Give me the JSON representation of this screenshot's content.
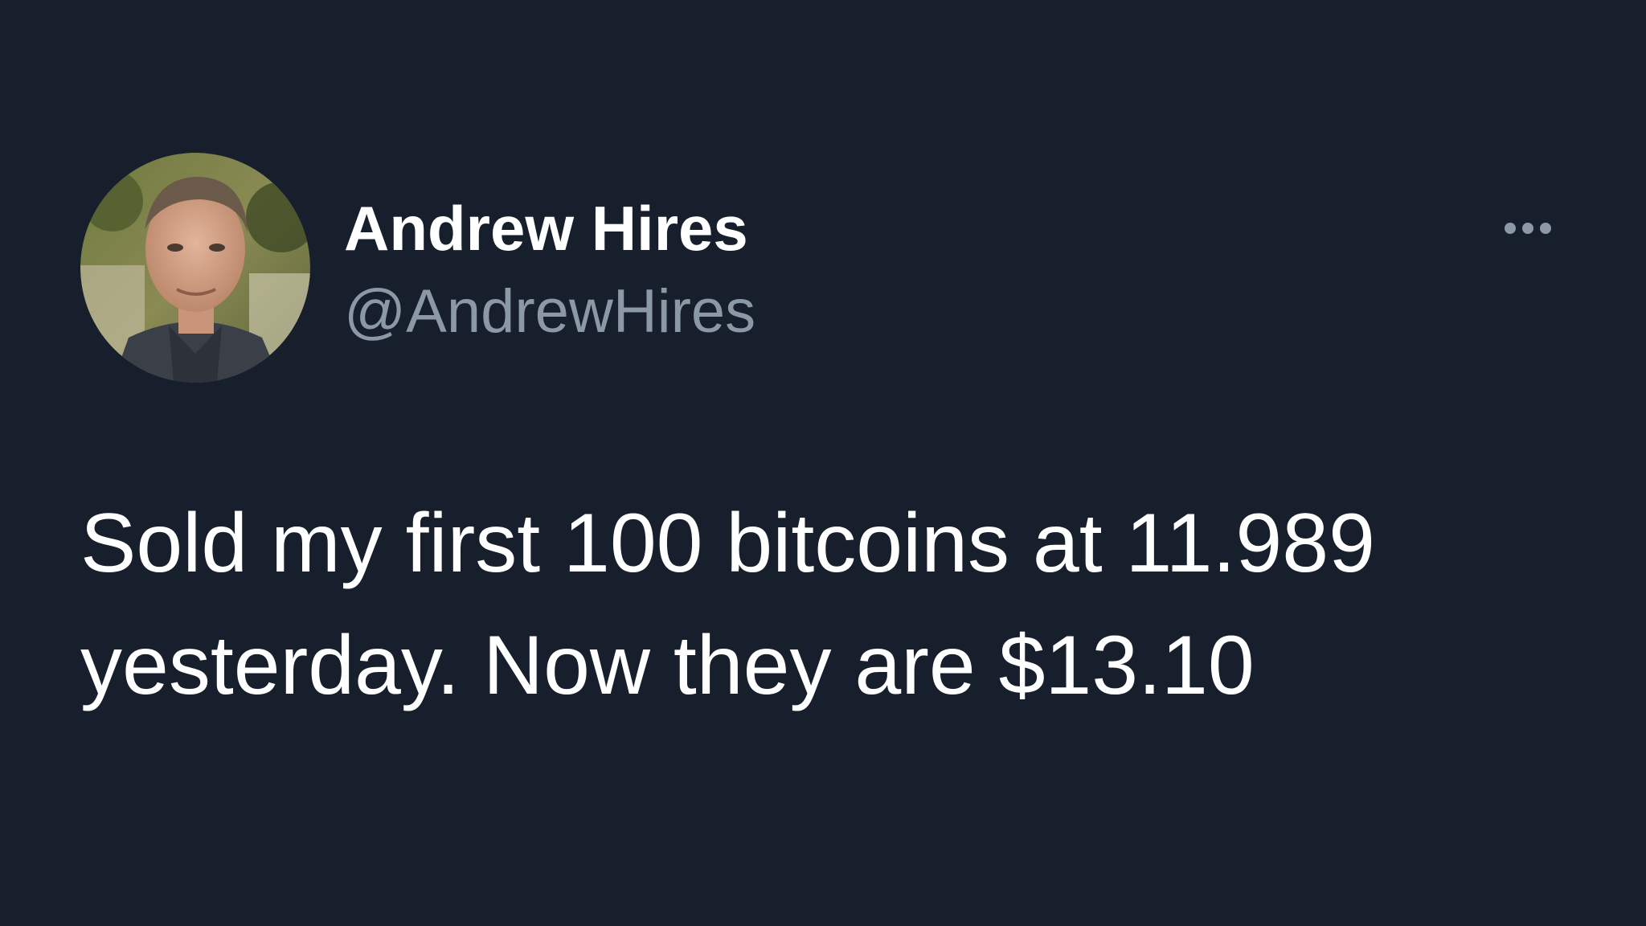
{
  "tweet": {
    "author": {
      "display_name": "Andrew Hires",
      "handle": "@AndrewHires",
      "avatar_icon": "profile-photo"
    },
    "more_icon": "ellipsis-icon",
    "text_line_1": "Sold my first 100 bitcoins at 11.989",
    "text_line_2": "yesterday.  Now they are $13.10"
  },
  "colors": {
    "background": "#171f2c",
    "primary_text": "#ffffff",
    "secondary_text": "#8b98a5"
  }
}
